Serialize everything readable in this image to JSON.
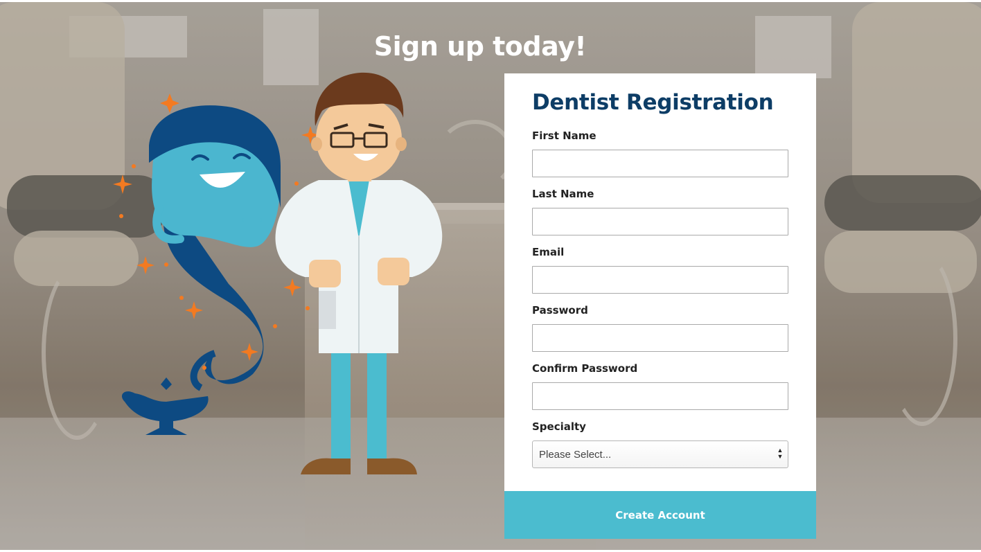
{
  "page": {
    "headline": "Sign up today!"
  },
  "form": {
    "title": "Dentist Registration",
    "fields": [
      {
        "label": "First Name",
        "value": ""
      },
      {
        "label": "Last Name",
        "value": ""
      },
      {
        "label": "Email",
        "value": ""
      },
      {
        "label": "Password",
        "value": ""
      },
      {
        "label": "Confirm Password",
        "value": ""
      }
    ],
    "specialty": {
      "label": "Specialty",
      "selected": "Please Select..."
    },
    "submit_label": "Create Account"
  },
  "illustration": {
    "characters": [
      "genie-character",
      "dentist-character",
      "magic-lamp"
    ]
  },
  "colors": {
    "title": "#0d3d66",
    "accent": "#4bbccf",
    "genie_dark": "#0d4a82",
    "genie_light": "#4bb6cf",
    "sparkle": "#f37a21"
  }
}
